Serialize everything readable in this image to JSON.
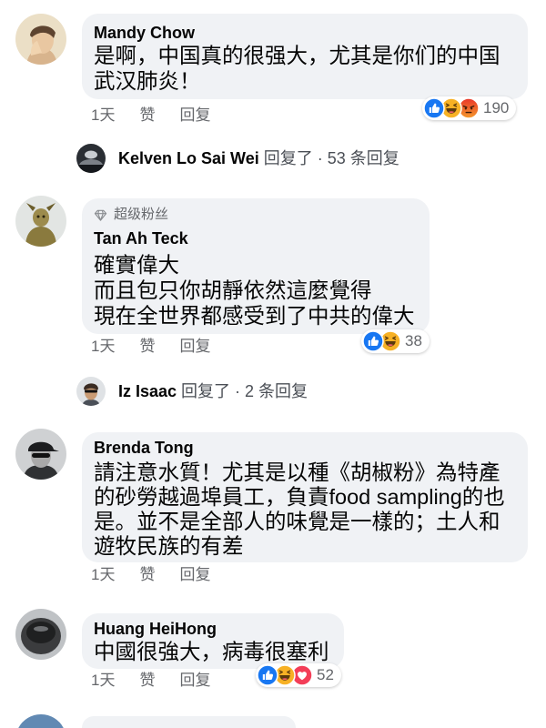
{
  "colors": {
    "bubble": "#f0f2f5",
    "meta_text": "#65676b",
    "like": "#1877f2",
    "haha": "#f7b125",
    "angry_top": "#e9352b",
    "angry_bottom": "#f49a2c",
    "love": "#f33e58"
  },
  "comments": [
    {
      "author": "Mandy Chow",
      "lines": [
        "是啊，中国真的很强大，尤其是你们的中国",
        "武汉肺炎！"
      ],
      "time": "1天",
      "like_label": "赞",
      "reply_label": "回复",
      "reactions": {
        "icons": [
          "like-icon",
          "haha-icon",
          "angry-icon"
        ],
        "count": "190"
      },
      "reply_summary": {
        "author": "Kelven Lo Sai Wei",
        "text": "回复了 · 53 条回复"
      }
    },
    {
      "badge": {
        "icon": "diamond-icon",
        "label": "超级粉丝"
      },
      "author": "Tan Ah Teck",
      "lines": [
        "確實偉大",
        "而且包只你胡靜依然這麼覺得",
        "現在全世界都感受到了中共的偉大"
      ],
      "time": "1天",
      "like_label": "赞",
      "reply_label": "回复",
      "reactions": {
        "icons": [
          "like-icon",
          "haha-icon"
        ],
        "count": "38"
      },
      "reply_summary": {
        "author": "Iz Isaac",
        "text": "回复了 · 2 条回复"
      }
    },
    {
      "author": "Brenda Tong",
      "lines": [
        "請注意水質！尤其是以種《胡椒粉》為特產",
        "的砂勞越過埠員工，負責food sampling的也",
        "是。並不是全部人的味覺是一樣的；土人和",
        "遊牧民族的有差"
      ],
      "time": "1天",
      "like_label": "赞",
      "reply_label": "回复"
    },
    {
      "author": "Huang HeiHong",
      "lines": [
        "中國很強大，病毒很塞利"
      ],
      "time": "1天",
      "like_label": "赞",
      "reply_label": "回复",
      "reactions": {
        "icons": [
          "like-icon",
          "haha-icon",
          "love-icon"
        ],
        "count": "52"
      }
    }
  ]
}
